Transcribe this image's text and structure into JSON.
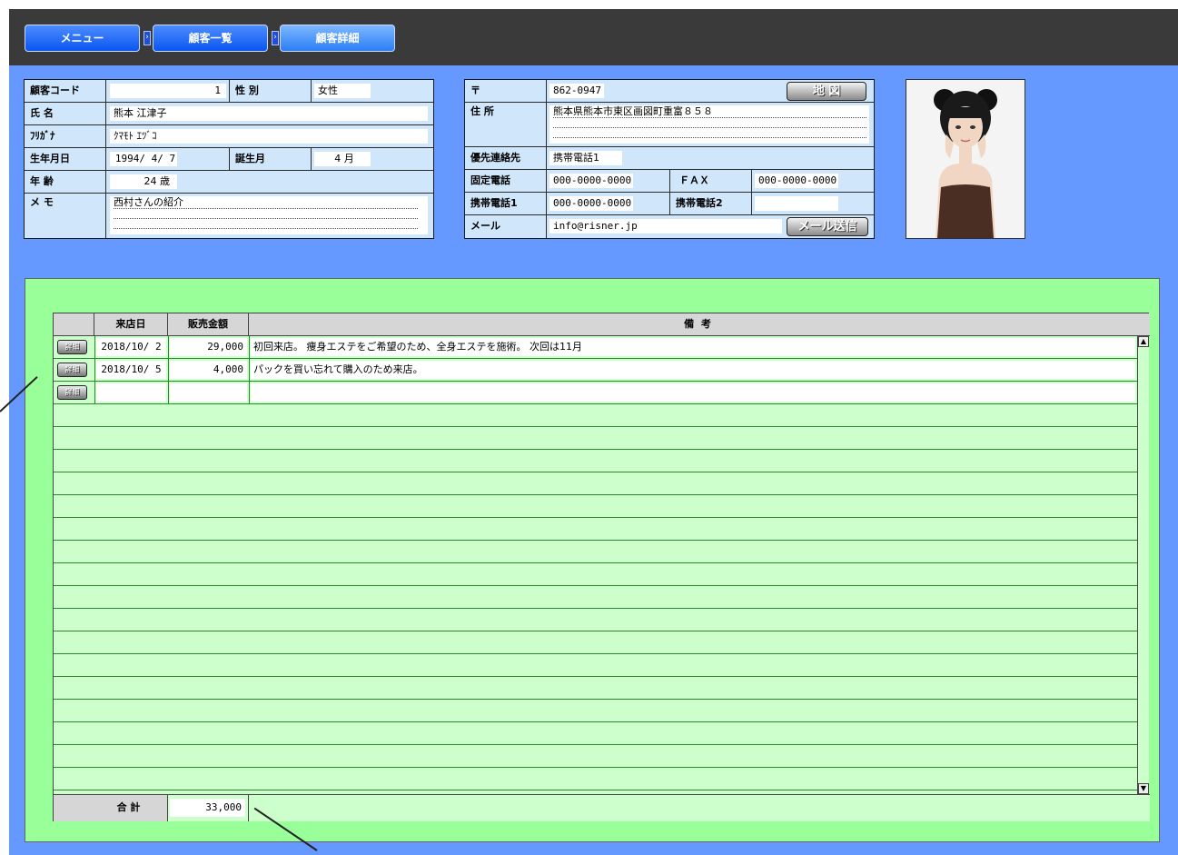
{
  "breadcrumb": [
    "メニュー",
    "顧客一覧",
    "顧客詳細"
  ],
  "customer": {
    "labels": {
      "code": "顧客コード",
      "gender": "性 別",
      "name": "氏 名",
      "kana": "ﾌﾘｶﾞﾅ",
      "birthdate": "生年月日",
      "birth_month": "誕生月",
      "age": "年 齢",
      "memo": "メ モ"
    },
    "code": "1",
    "gender": "女性",
    "name": "熊本 江津子",
    "kana": "ｸﾏﾓﾄ ｴﾂﾞｺ",
    "birthdate": "1994/ 4/ 7",
    "birth_month": "4 月",
    "age": "24 歳",
    "memo": "西村さんの紹介"
  },
  "contact": {
    "labels": {
      "zip": "〒",
      "address": "住 所",
      "priority": "優先連絡先",
      "phone": "固定電話",
      "fax": "ＦＡＸ",
      "mobile1": "携帯電話1",
      "mobile2": "携帯電話2",
      "mail": "メール"
    },
    "zip": "862-0947",
    "address": "熊本県熊本市東区画図町重富８５８",
    "priority": "携帯電話1",
    "phone": "000-0000-0000",
    "fax": "000-0000-0000",
    "mobile1": "000-0000-0000",
    "mobile2": "",
    "mail": "info@risner.jp",
    "map_button": "地 図",
    "mail_button": "メール送信"
  },
  "visits": {
    "headers": [
      "来店日",
      "販売金額",
      "備 考"
    ],
    "detail_button": "詳細",
    "rows": [
      {
        "date": "2018/10/ 2",
        "amount": "29,000",
        "note": "初回来店。 痩身エステをご希望のため、全身エステを施術。 次回は11月"
      },
      {
        "date": "2018/10/ 5",
        "amount": "4,000",
        "note": "パックを買い忘れて購入のため来店。"
      },
      {
        "date": "",
        "amount": "",
        "note": ""
      }
    ],
    "total_label": "合 計",
    "total": "33,000"
  },
  "scroll_icons": {
    "up": "scroll-up-arrow-icon",
    "down": "scroll-down-arrow-icon"
  },
  "colors": {
    "background": "#6699ff",
    "header_bar": "#3a3a3a",
    "grid_bg": "#ccffcc",
    "outer_green": "#99ff99",
    "label_bg": "#cfe6fb"
  }
}
